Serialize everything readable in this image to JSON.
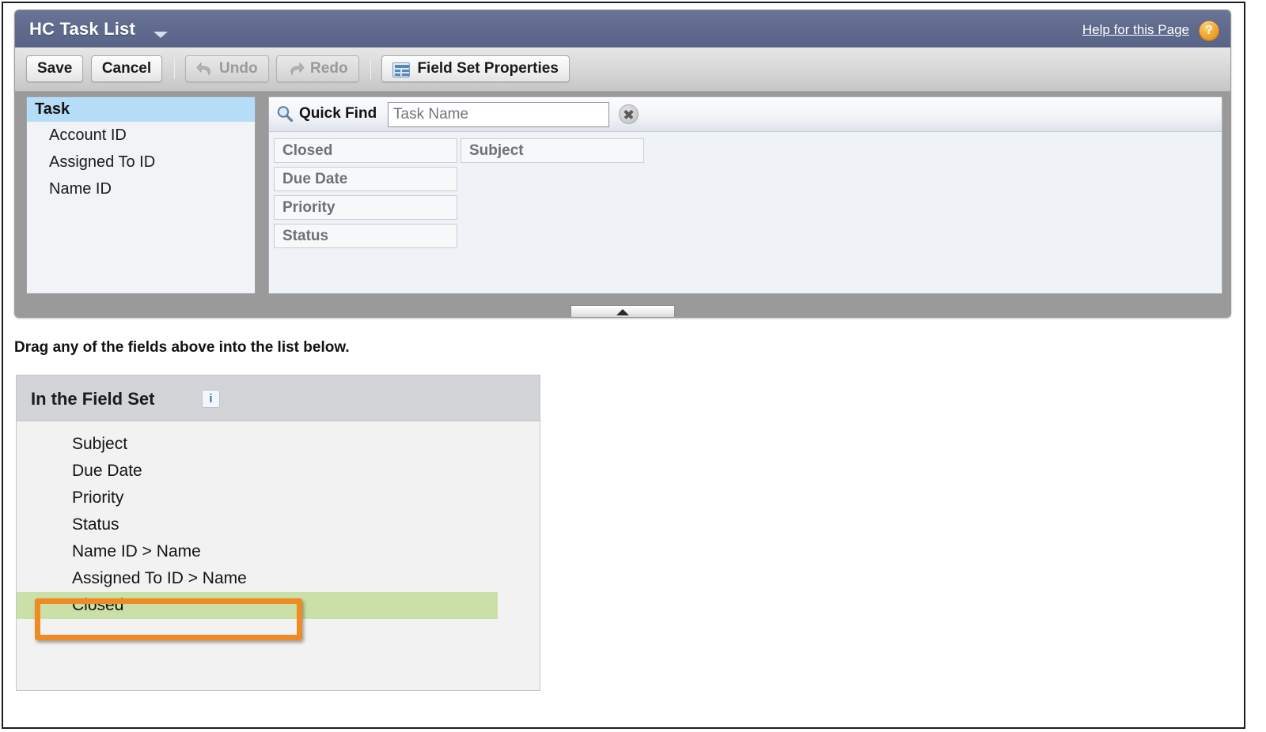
{
  "window": {
    "title": "HC Task List",
    "title_menu_icon": "chevron-down-icon",
    "help_link": "Help for this Page",
    "help_icon": "question-mark-icon"
  },
  "toolbar": {
    "save_label": "Save",
    "cancel_label": "Cancel",
    "undo_label": "Undo",
    "redo_label": "Redo",
    "field_set_properties_label": "Field Set Properties",
    "undo_enabled": false,
    "redo_enabled": false
  },
  "object_panel": {
    "header": "Task",
    "fields": [
      {
        "label": "Account ID"
      },
      {
        "label": "Assigned To ID"
      },
      {
        "label": "Name ID"
      }
    ]
  },
  "palette": {
    "quick_find_label": "Quick Find",
    "quick_find_value": "",
    "quick_find_placeholder": "Task Name",
    "search_icon": "magnifier-icon",
    "clear_icon": "clear-x-icon",
    "column_0": [
      {
        "label": "Closed"
      },
      {
        "label": "Due Date"
      },
      {
        "label": "Priority"
      },
      {
        "label": "Status"
      }
    ],
    "column_1": [
      {
        "label": "Subject"
      }
    ]
  },
  "collapse_handle": {
    "icon": "triangle-up-icon"
  },
  "drag_hint": "Drag any of the fields above into the list below.",
  "field_set": {
    "header": "In the Field Set",
    "info_icon": "info-icon",
    "rows": [
      {
        "label": "Subject",
        "highlighted": false
      },
      {
        "label": "Due Date",
        "highlighted": false
      },
      {
        "label": "Priority",
        "highlighted": false
      },
      {
        "label": "Status",
        "highlighted": false
      },
      {
        "label": "Name ID > Name",
        "highlighted": false
      },
      {
        "label": "Assigned To ID > Name",
        "highlighted": false
      },
      {
        "label": "Closed",
        "highlighted": true
      }
    ]
  },
  "colors": {
    "titlebar": "#5f6a8d",
    "object_header_selected": "#b5ddf7",
    "drop_highlight_green": "#cbdfa9",
    "callout_orange": "#ef8b22",
    "help_icon_orange": "#f3ab32"
  }
}
